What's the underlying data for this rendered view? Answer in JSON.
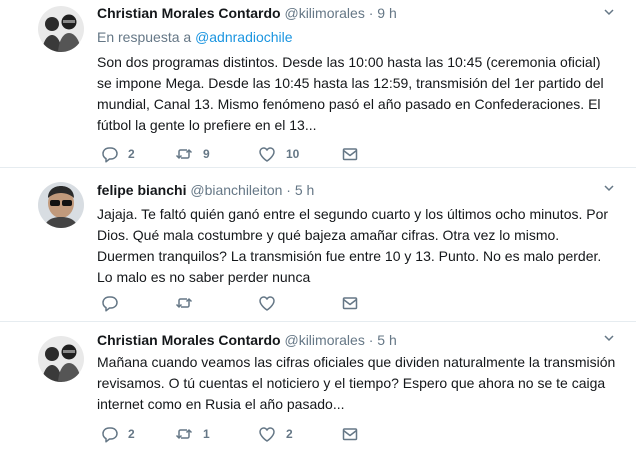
{
  "tweets": [
    {
      "name": "Christian Morales Contardo",
      "handle": "@kilimorales",
      "dot": "·",
      "time": "9 h",
      "reply_prefix": "En respuesta a",
      "reply_handle": "@adnradiochile",
      "text": "Son dos programas distintos. Desde las 10:00 hasta las 10:45 (ceremonia oficial) se impone Mega. Desde las 10:45 hasta las 12:59, transmisión del 1er partido del mundial, Canal 13. Mismo fenómeno pasó el año pasado en Confederaciones. El fútbol la gente lo prefiere en el 13...",
      "reply_count": "2",
      "retweet_count": "9",
      "like_count": "10"
    },
    {
      "name": "felipe bianchi",
      "handle": "@bianchileiton",
      "dot": "·",
      "time": "5 h",
      "text": "Jajaja. Te faltó quién ganó entre el segundo cuarto y los últimos ocho minutos. Por Dios. Qué mala costumbre y qué bajeza amañar cifras. Otra vez lo mismo. Duermen tranquilos? La transmisión fue entre 10 y 13. Punto. No es malo perder. Lo malo es no saber perder nunca",
      "reply_count": "",
      "retweet_count": "",
      "like_count": ""
    },
    {
      "name": "Christian Morales Contardo",
      "handle": "@kilimorales",
      "dot": "·",
      "time": "5 h",
      "text": "Mañana cuando veamos las cifras oficiales que dividen naturalmente la transmisión revisamos. O tú cuentas el noticiero y el tiempo? Espero que ahora no se te caiga internet como en Rusia el año pasado...",
      "reply_count": "2",
      "retweet_count": "1",
      "like_count": "2"
    }
  ],
  "icons": {
    "reply": "reply-icon",
    "retweet": "retweet-icon",
    "like": "heart-icon",
    "message": "envelope-icon",
    "menu": "chevron-down-icon"
  },
  "colors": {
    "text": "#14171a",
    "secondary": "#657786",
    "link": "#1b95e0",
    "divider": "#e6ecf0"
  }
}
